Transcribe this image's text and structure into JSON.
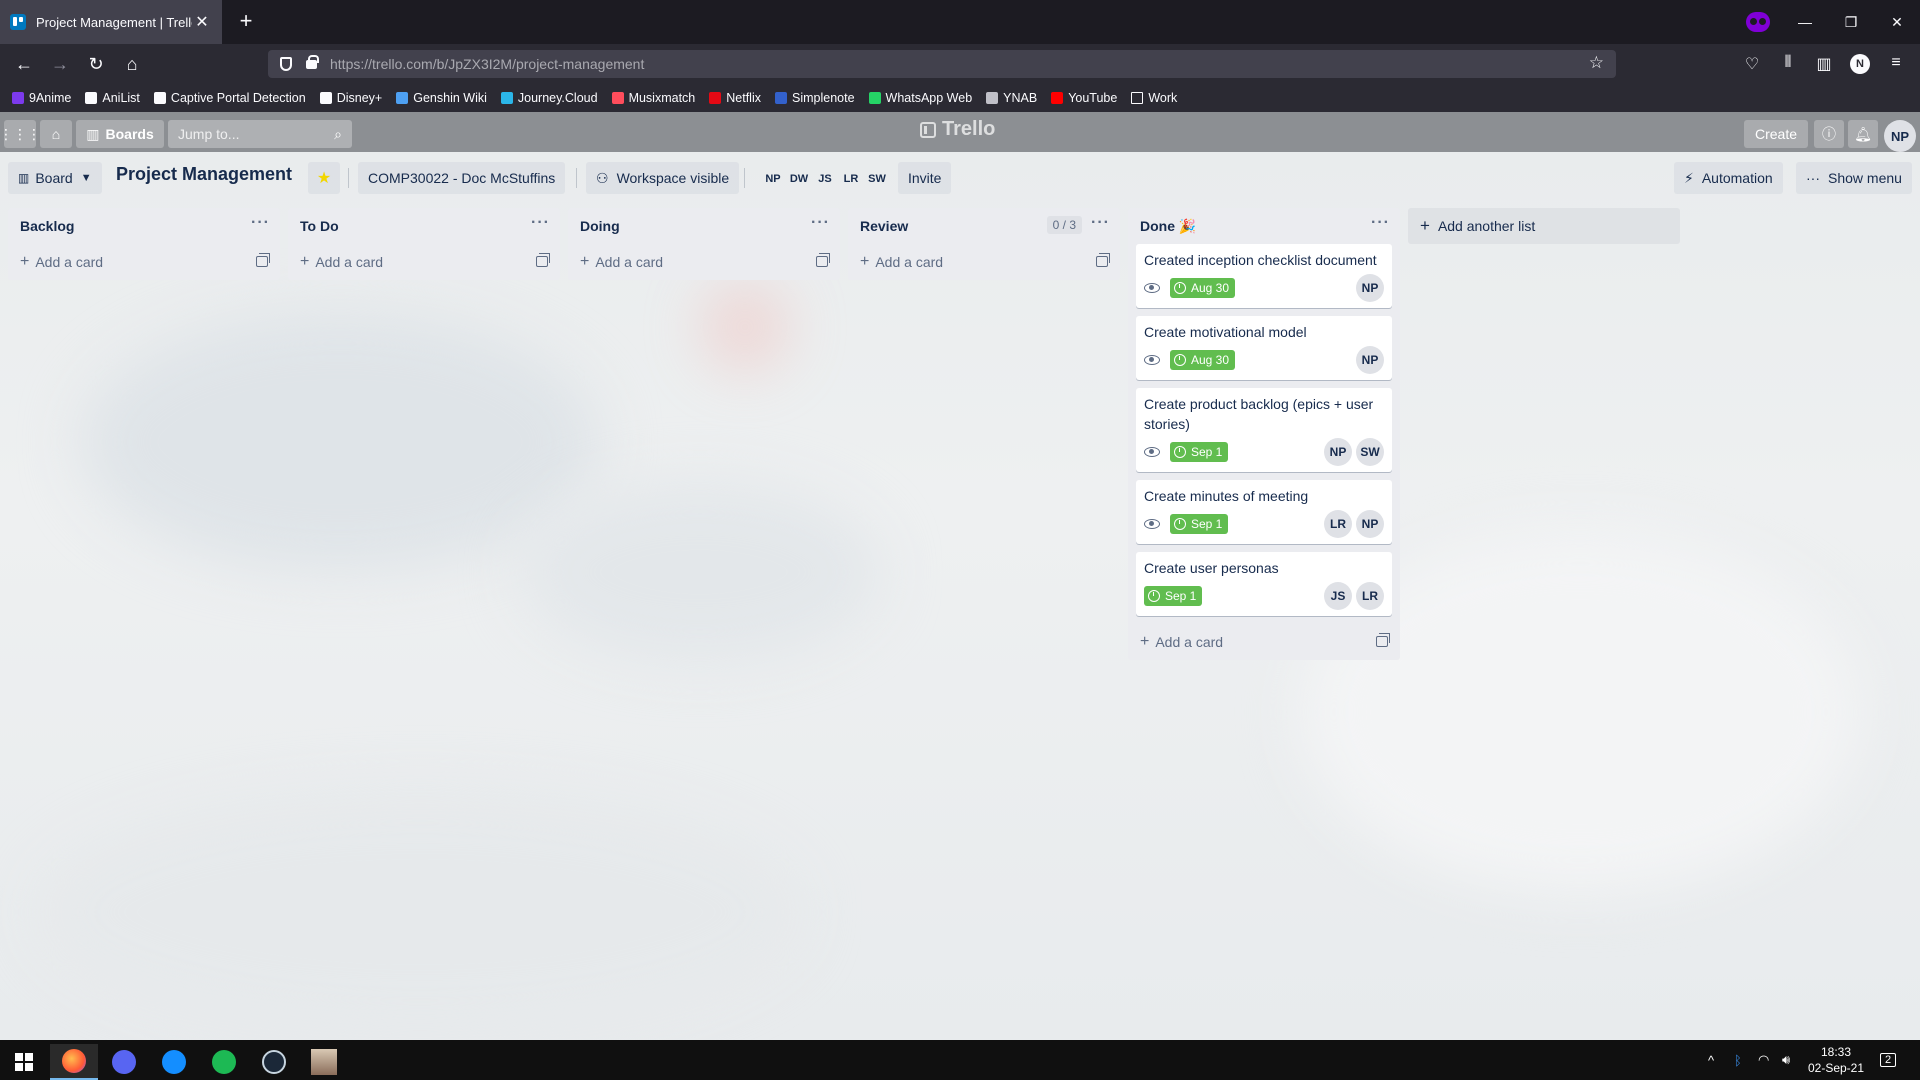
{
  "browser": {
    "tab_title": "Project Management | Trello",
    "tab_close": "✕",
    "new_tab": "+",
    "url": "https://trello.com/b/JpZX3I2M/project-management",
    "window_controls": [
      "—",
      "❐",
      "✕"
    ]
  },
  "bookmarks": [
    {
      "label": "9Anime",
      "color": "#7c3aed"
    },
    {
      "label": "AniList",
      "color": "#fbfbfe"
    },
    {
      "label": "Captive Portal Detection",
      "color": "#fbfbfe"
    },
    {
      "label": "Disney+",
      "color": "#fbfbfe"
    },
    {
      "label": "Genshin Wiki",
      "color": "#4ea0f2"
    },
    {
      "label": "Journey.Cloud",
      "color": "#2bb6e9"
    },
    {
      "label": "Musixmatch",
      "color": "#ff4d5c"
    },
    {
      "label": "Netflix",
      "color": "#e50914"
    },
    {
      "label": "Simplenote",
      "color": "#3361cc"
    },
    {
      "label": "WhatsApp Web",
      "color": "#25d366"
    },
    {
      "label": "YNAB",
      "color": "#c0c0c8"
    },
    {
      "label": "YouTube",
      "color": "#ff0000"
    },
    {
      "label": "Work",
      "color": "#fbfbfe"
    }
  ],
  "trello_header": {
    "boards_label": "Boards",
    "search_placeholder": "Jump to...",
    "logo_text": "Trello",
    "create_label": "Create",
    "user_initials": "NP"
  },
  "board_bar": {
    "view_label": "Board",
    "title": "Project Management",
    "workspace_label": "COMP30022 - Doc McStuffins",
    "visibility_label": "Workspace visible",
    "members": [
      "NP",
      "DW",
      "JS",
      "LR",
      "SW"
    ],
    "invite_label": "Invite",
    "automation_label": "Automation",
    "menu_label": "Show menu"
  },
  "lists": [
    {
      "title": "Backlog",
      "add_label": "Add a card",
      "cards": []
    },
    {
      "title": "To Do",
      "add_label": "Add a card",
      "cards": []
    },
    {
      "title": "Doing",
      "add_label": "Add a card",
      "cards": []
    },
    {
      "title": "Review",
      "wip": "0 / 3",
      "add_label": "Add a card",
      "cards": []
    },
    {
      "title": "Done 🎉",
      "add_label": "Add a card",
      "cards": [
        {
          "title": "Created inception checklist document",
          "watched": true,
          "due": "Aug 30",
          "members": [
            "NP"
          ]
        },
        {
          "title": "Create motivational model",
          "watched": true,
          "due": "Aug 30",
          "members": [
            "NP"
          ]
        },
        {
          "title": "Create product backlog (epics + user stories)",
          "watched": true,
          "due": "Sep 1",
          "members": [
            "NP",
            "SW"
          ]
        },
        {
          "title": "Create minutes of meeting",
          "watched": true,
          "due": "Sep 1",
          "members": [
            "LR",
            "NP"
          ]
        },
        {
          "title": "Create user personas",
          "watched": false,
          "due": "Sep 1",
          "members": [
            "JS",
            "LR"
          ]
        }
      ]
    }
  ],
  "add_list_label": "Add another list",
  "list_menu": "···",
  "taskbar": {
    "time": "18:33",
    "date": "02-Sep-21",
    "notifications": "2",
    "tray_up": "^"
  },
  "colors": {
    "due_complete": "#61bd4f",
    "trello_header": "#8c8f93",
    "star": "#f2d600"
  }
}
